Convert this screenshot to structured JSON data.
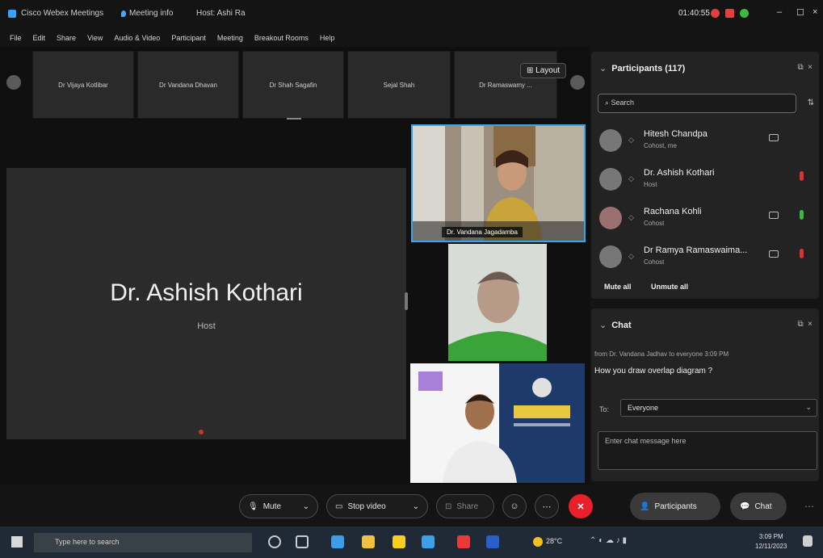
{
  "titlebar": {
    "app_title": "Cisco Webex Meetings",
    "meeting_info": "Meeting info",
    "host_label": "Host: Ashi Ra",
    "time": "01:40:55"
  },
  "menu": [
    "File",
    "Edit",
    "Share",
    "View",
    "Audio & Video",
    "Participant",
    "Meeting",
    "Breakout Rooms",
    "Help"
  ],
  "strip": {
    "thumbnails": [
      "Dr Vijaya Kotlibar",
      "Dr Vandana Dhavan",
      "Dr Shah Sagafin",
      "Sejal Shah",
      "Dr Ramaswamy ..."
    ],
    "layout_label": "Layout"
  },
  "stage": {
    "speaker_name": "Dr. Ashish Kothari",
    "speaker_role": "Host",
    "video_name_1": "Dr. Vandana Jagadamba"
  },
  "participants": {
    "title": "Participants (117)",
    "search_placeholder": "Search",
    "list": [
      {
        "name": "Hitesh Chandpa",
        "role": "Cohost, me"
      },
      {
        "name": "Dr. Ashish Kothari",
        "role": "Host"
      },
      {
        "name": "Rachana Kohli",
        "role": "Cohost"
      },
      {
        "name": "Dr Ramya Ramaswaima...",
        "role": "Cohost"
      }
    ],
    "mute_all": "Mute all",
    "unmute_all": "Unmute all"
  },
  "chat": {
    "title": "Chat",
    "from_line": "from Dr. Vandana Jadhav to everyone   3:09 PM",
    "message": "How you draw overlap diagram ?",
    "to_label": "To:",
    "recipient": "Everyone",
    "input_placeholder": "Enter chat message here"
  },
  "controls": {
    "mute": "Mute",
    "stop_video": "Stop video",
    "share": "Share",
    "participants": "Participants",
    "chat": "Chat"
  },
  "taskbar": {
    "search_placeholder": "Type here to search",
    "weather": "28°C",
    "clock_time": "3:09 PM",
    "clock_date": "12/11/2023"
  },
  "colors": {
    "active_border": "#34a8e8",
    "end_red": "#e8202a",
    "mic_red": "#e03030",
    "mic_green": "#3cba3c"
  }
}
